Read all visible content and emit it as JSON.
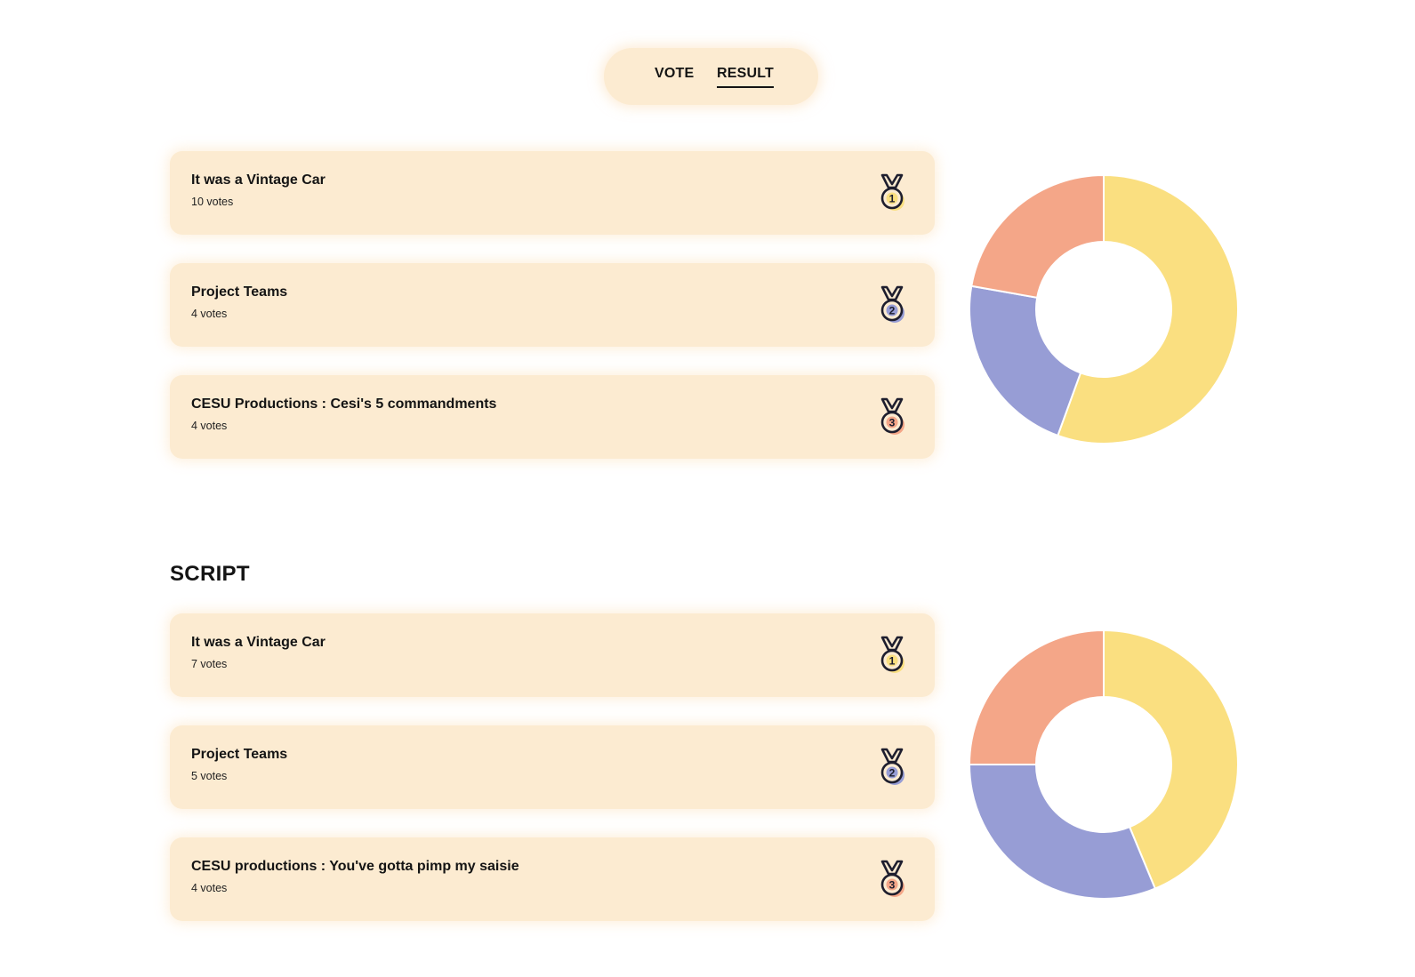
{
  "nav": {
    "tabs": [
      {
        "label": "VOTE",
        "active": false
      },
      {
        "label": "RESULT",
        "active": true
      }
    ]
  },
  "colors": {
    "card_bg": "#fcebd1",
    "gold": "#fadf80",
    "silver": "#979dd5",
    "bronze": "#f4a688",
    "ink": "#141414"
  },
  "icons": {
    "medal": "medal-icon"
  },
  "sections": [
    {
      "title": "",
      "items": [
        {
          "title": "It was a Vintage Car",
          "votes": 10,
          "votes_label": "10 votes",
          "rank": "1"
        },
        {
          "title": "Project Teams",
          "votes": 4,
          "votes_label": "4 votes",
          "rank": "2"
        },
        {
          "title": "CESU Productions : Cesi's 5 commandments",
          "votes": 4,
          "votes_label": "4 votes",
          "rank": "3"
        }
      ]
    },
    {
      "title": "SCRIPT",
      "items": [
        {
          "title": "It was a Vintage Car",
          "votes": 7,
          "votes_label": "7 votes",
          "rank": "1"
        },
        {
          "title": "Project Teams",
          "votes": 5,
          "votes_label": "5 votes",
          "rank": "2"
        },
        {
          "title": "CESU productions : You've gotta pimp my saisie",
          "votes": 4,
          "votes_label": "4 votes",
          "rank": "3"
        }
      ]
    }
  ],
  "chart_data": [
    {
      "type": "pie",
      "categories": [
        "It was a Vintage Car",
        "Project Teams",
        "CESU Productions : Cesi's 5 commandments"
      ],
      "values": [
        10,
        4,
        4
      ],
      "colors": [
        "#fadf80",
        "#979dd5",
        "#f4a688"
      ]
    },
    {
      "type": "pie",
      "categories": [
        "It was a Vintage Car",
        "Project Teams",
        "CESU productions : You've gotta pimp my saisie"
      ],
      "values": [
        7,
        5,
        4
      ],
      "colors": [
        "#fadf80",
        "#979dd5",
        "#f4a688"
      ]
    }
  ]
}
